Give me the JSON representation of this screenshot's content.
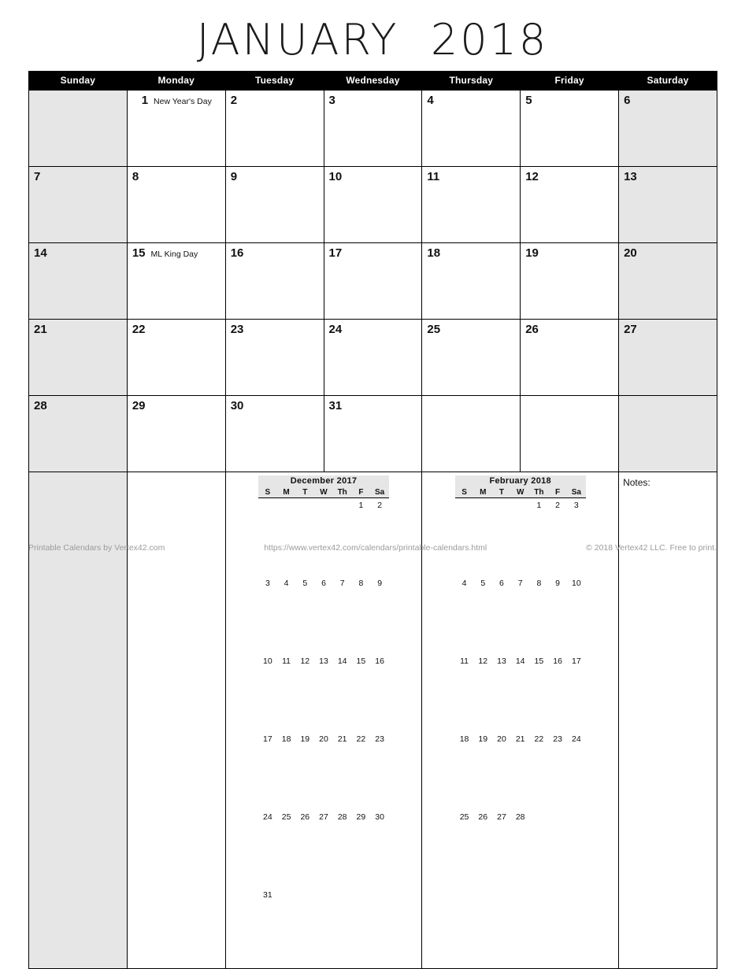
{
  "title": "JANUARY  2018",
  "colors": {
    "header_bg": "#000000",
    "header_text": "#ffffff",
    "weekend_bg": "#e6e6e6",
    "grid_line": "#000000",
    "footer_text": "#9b9b9b"
  },
  "weekdays": [
    "Sunday",
    "Monday",
    "Tuesday",
    "Wednesday",
    "Thursday",
    "Friday",
    "Saturday"
  ],
  "weeks": [
    [
      {
        "num": "",
        "event": ""
      },
      {
        "num": "1",
        "event": "New Year's Day"
      },
      {
        "num": "2",
        "event": ""
      },
      {
        "num": "3",
        "event": ""
      },
      {
        "num": "4",
        "event": ""
      },
      {
        "num": "5",
        "event": ""
      },
      {
        "num": "6",
        "event": ""
      }
    ],
    [
      {
        "num": "7",
        "event": ""
      },
      {
        "num": "8",
        "event": ""
      },
      {
        "num": "9",
        "event": ""
      },
      {
        "num": "10",
        "event": ""
      },
      {
        "num": "11",
        "event": ""
      },
      {
        "num": "12",
        "event": ""
      },
      {
        "num": "13",
        "event": ""
      }
    ],
    [
      {
        "num": "14",
        "event": ""
      },
      {
        "num": "15",
        "event": "ML King Day"
      },
      {
        "num": "16",
        "event": ""
      },
      {
        "num": "17",
        "event": ""
      },
      {
        "num": "18",
        "event": ""
      },
      {
        "num": "19",
        "event": ""
      },
      {
        "num": "20",
        "event": ""
      }
    ],
    [
      {
        "num": "21",
        "event": ""
      },
      {
        "num": "22",
        "event": ""
      },
      {
        "num": "23",
        "event": ""
      },
      {
        "num": "24",
        "event": ""
      },
      {
        "num": "25",
        "event": ""
      },
      {
        "num": "26",
        "event": ""
      },
      {
        "num": "27",
        "event": ""
      }
    ],
    [
      {
        "num": "28",
        "event": ""
      },
      {
        "num": "29",
        "event": ""
      },
      {
        "num": "30",
        "event": ""
      },
      {
        "num": "31",
        "event": ""
      },
      {
        "num": "",
        "event": ""
      },
      {
        "num": "",
        "event": ""
      },
      {
        "num": "",
        "event": ""
      }
    ]
  ],
  "mini_calendars": [
    {
      "title": "December 2017",
      "dow": [
        "S",
        "M",
        "T",
        "W",
        "Th",
        "F",
        "Sa"
      ],
      "weeks": [
        [
          "",
          "",
          "",
          "",
          "",
          "1",
          "2"
        ],
        [
          "3",
          "4",
          "5",
          "6",
          "7",
          "8",
          "9"
        ],
        [
          "10",
          "11",
          "12",
          "13",
          "14",
          "15",
          "16"
        ],
        [
          "17",
          "18",
          "19",
          "20",
          "21",
          "22",
          "23"
        ],
        [
          "24",
          "25",
          "26",
          "27",
          "28",
          "29",
          "30"
        ],
        [
          "31",
          "",
          "",
          "",
          "",
          "",
          ""
        ]
      ]
    },
    {
      "title": "February 2018",
      "dow": [
        "S",
        "M",
        "T",
        "W",
        "Th",
        "F",
        "Sa"
      ],
      "weeks": [
        [
          "",
          "",
          "",
          "",
          "1",
          "2",
          "3"
        ],
        [
          "4",
          "5",
          "6",
          "7",
          "8",
          "9",
          "10"
        ],
        [
          "11",
          "12",
          "13",
          "14",
          "15",
          "16",
          "17"
        ],
        [
          "18",
          "19",
          "20",
          "21",
          "22",
          "23",
          "24"
        ],
        [
          "25",
          "26",
          "27",
          "28",
          "",
          "",
          ""
        ]
      ]
    }
  ],
  "notes": {
    "label": "Notes:"
  },
  "footer": {
    "left": "Printable Calendars by Vertex42.com",
    "center": "https://www.vertex42.com/calendars/printable-calendars.html",
    "right": "© 2018 Vertex42 LLC. Free to print."
  }
}
